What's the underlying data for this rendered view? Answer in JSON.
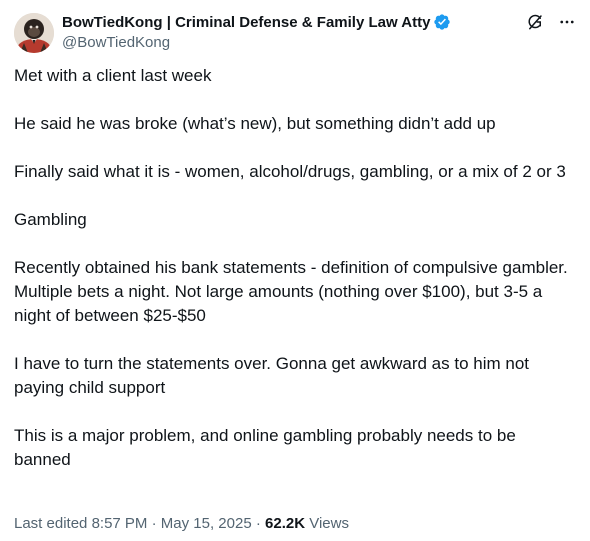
{
  "author": {
    "display_name": "BowTiedKong | Criminal Defense & Family Law Atty",
    "handle": "@BowTiedKong",
    "verified": true,
    "avatar_icon": "gorilla-avatar-icon"
  },
  "actions": {
    "grok_icon": "grok-icon",
    "more_icon": "more-options-icon"
  },
  "post": {
    "paragraphs": [
      "Met with a client last week",
      "He said he was broke (what’s new), but something didn’t add up",
      "Finally said what it is - women, alcohol/drugs, gambling, or a mix of 2 or 3",
      "Gambling",
      "Recently obtained his bank statements - definition of compulsive gambler. Multiple bets a night. Not large amounts (nothing over $100), but 3-5 a night of between $25-$50",
      "I have to turn the statements over. Gonna get awkward as to him not paying child support",
      "This is a major problem, and online gambling probably needs to be banned"
    ]
  },
  "meta": {
    "edited_label": "Last edited",
    "time": "8:57 PM",
    "separator": " · ",
    "date": "May 15, 2025",
    "views_count": "62.2K",
    "views_label": "Views"
  },
  "colors": {
    "text_primary": "#0f1419",
    "text_secondary": "#536471",
    "verified_blue": "#1d9bf0"
  }
}
